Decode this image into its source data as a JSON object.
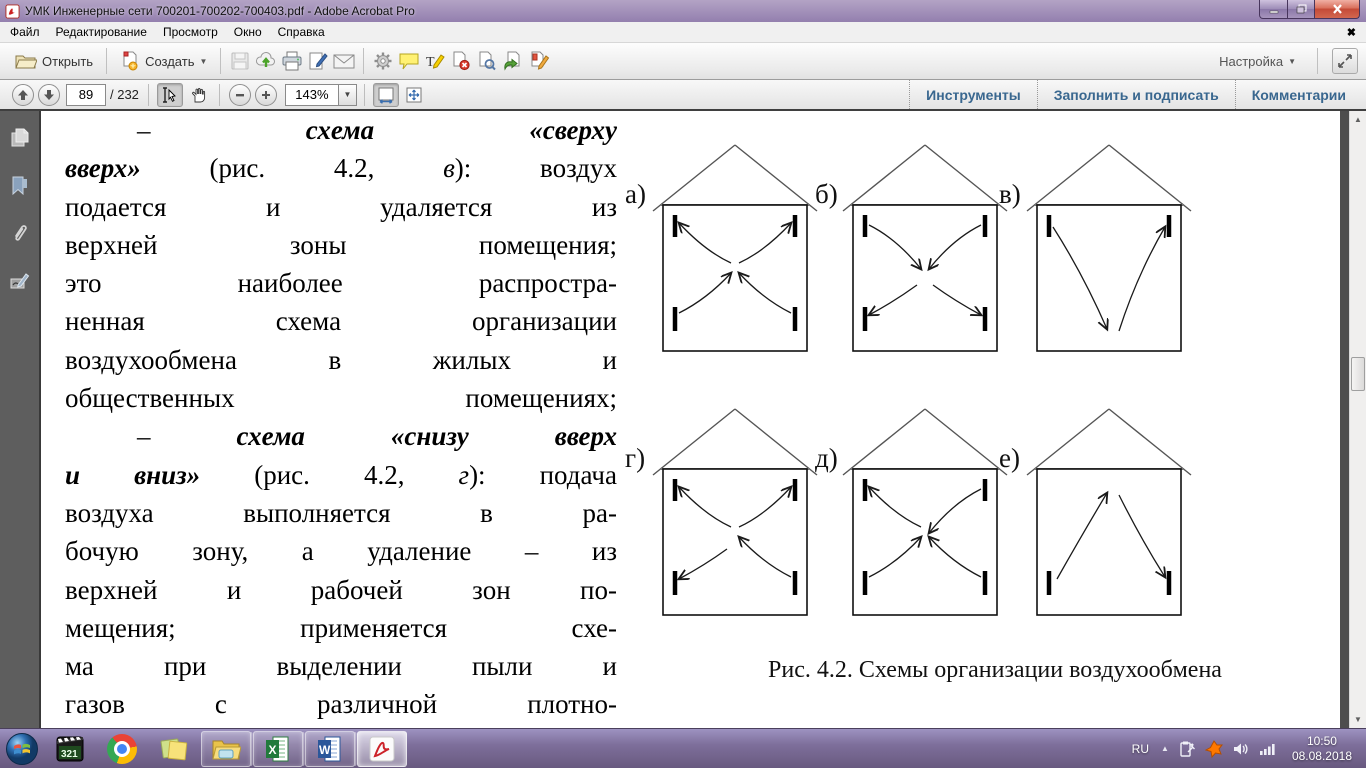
{
  "window": {
    "title": "УМК Инженерные сети 700201-700202-700403.pdf - Adobe Acrobat Pro",
    "controls": {
      "minimize": "minimize",
      "restore": "restore",
      "close": "close"
    }
  },
  "menubar": {
    "items": [
      "Файл",
      "Редактирование",
      "Просмотр",
      "Окно",
      "Справка"
    ],
    "doc_close_glyph": "✖"
  },
  "toolbar": {
    "open_label": "Открыть",
    "create_label": "Создать",
    "settings_label": "Настройка",
    "icons": [
      "open-folder-icon",
      "create-pdf-icon",
      "save-icon",
      "upload-cloud-icon",
      "print-icon",
      "sign-icon",
      "email-icon",
      "gear-icon",
      "comment-icon",
      "highlight-text-icon",
      "delete-pages-icon",
      "search-pages-icon",
      "send-pages-icon",
      "edit-document-icon",
      "reading-mode-icon"
    ]
  },
  "navbar": {
    "page_current": "89",
    "page_total": "/ 232",
    "zoom_level": "143%",
    "right_buttons": [
      "Инструменты",
      "Заполнить и подписать",
      "Комментарии"
    ]
  },
  "sidebar": {
    "icons": [
      "page-thumbnails-icon",
      "bookmarks-icon",
      "attachments-icon",
      "signatures-icon"
    ]
  },
  "document": {
    "text_lines": [
      {
        "indent": true,
        "segments": [
          {
            "t": "– ",
            "s": "n"
          },
          {
            "t": "схема «сверху",
            "s": "bi"
          }
        ]
      },
      {
        "indent": false,
        "segments": [
          {
            "t": "вверх»",
            "s": "bi"
          },
          {
            "t": " (рис. 4.2, ",
            "s": "n"
          },
          {
            "t": "в",
            "s": "i"
          },
          {
            "t": "): воздух",
            "s": "n"
          }
        ]
      },
      {
        "indent": false,
        "segments": [
          {
            "t": "подается и удаляется из",
            "s": "n"
          }
        ]
      },
      {
        "indent": false,
        "segments": [
          {
            "t": "верхней зоны помещения;",
            "s": "n"
          }
        ]
      },
      {
        "indent": false,
        "segments": [
          {
            "t": "это наиболее распростра-",
            "s": "n"
          }
        ]
      },
      {
        "indent": false,
        "segments": [
          {
            "t": "ненная схема организации",
            "s": "n"
          }
        ]
      },
      {
        "indent": false,
        "segments": [
          {
            "t": "воздухообмена в жилых и",
            "s": "n"
          }
        ]
      },
      {
        "indent": false,
        "segments": [
          {
            "t": "общественных помещениях;",
            "s": "n"
          }
        ]
      },
      {
        "indent": true,
        "segments": [
          {
            "t": "– ",
            "s": "n"
          },
          {
            "t": "схема «снизу вверх",
            "s": "bi"
          }
        ]
      },
      {
        "indent": false,
        "segments": [
          {
            "t": "и вниз»",
            "s": "bi"
          },
          {
            "t": " (рис. 4.2, ",
            "s": "n"
          },
          {
            "t": "г",
            "s": "i"
          },
          {
            "t": "): подача",
            "s": "n"
          }
        ]
      },
      {
        "indent": false,
        "segments": [
          {
            "t": "воздуха выполняется в ра-",
            "s": "n"
          }
        ]
      },
      {
        "indent": false,
        "segments": [
          {
            "t": "бочую зону, а удаление – из",
            "s": "n"
          }
        ]
      },
      {
        "indent": false,
        "segments": [
          {
            "t": "верхней и рабочей зон по-",
            "s": "n"
          }
        ]
      },
      {
        "indent": false,
        "segments": [
          {
            "t": "мещения; применяется схе-",
            "s": "n"
          }
        ]
      },
      {
        "indent": false,
        "segments": [
          {
            "t": "ма при выделении пыли и",
            "s": "n"
          }
        ]
      },
      {
        "indent": false,
        "segments": [
          {
            "t": "газов с различной плотно-",
            "s": "n"
          }
        ]
      }
    ],
    "figure": {
      "caption": "Рис. 4.2. Схемы организации воздухообмена",
      "diagrams": [
        {
          "label": "а)",
          "ticks": [
            "tl",
            "tr",
            "bl",
            "br"
          ],
          "arrows": [
            "bl-to-center",
            "br-to-center",
            "center-to-tl",
            "center-to-tr"
          ]
        },
        {
          "label": "б)",
          "ticks": [
            "tl",
            "tr",
            "bl",
            "br"
          ],
          "arrows": [
            "tl-to-center",
            "tr-to-center",
            "center-to-bl",
            "center-to-br"
          ]
        },
        {
          "label": "в)",
          "ticks": [
            "tl",
            "tr"
          ],
          "arrows": [
            "tl-to-bottom",
            "bottom-to-tr"
          ]
        },
        {
          "label": "г)",
          "ticks": [
            "tl",
            "tr",
            "bl",
            "br"
          ],
          "arrows": [
            "center-to-tl",
            "center-to-tr",
            "center-to-bl",
            "br-to-center"
          ]
        },
        {
          "label": "д)",
          "ticks": [
            "tl",
            "tr",
            "bl",
            "br"
          ],
          "arrows": [
            "center-to-tl",
            "tr-to-center",
            "bl-to-center",
            "br-to-center"
          ]
        },
        {
          "label": "е)",
          "ticks": [
            "bl",
            "br"
          ],
          "arrows": [
            "bl-to-top",
            "top-to-br"
          ]
        }
      ]
    }
  },
  "taskbar": {
    "apps": [
      "start",
      "media-player-321",
      "chrome",
      "sticky-notes",
      "explorer",
      "excel",
      "word",
      "acrobat"
    ],
    "media_player_label": "321",
    "tray": {
      "lang": "RU",
      "time": "10:50",
      "date": "08.08.2018"
    }
  },
  "colors": {
    "titlebar": "#a693bd",
    "taskbar": "#7e6f9b",
    "accent_blue_links": "#39678f",
    "sidebar_gray": "#5e5e5e",
    "close_button_red": "#c44a37"
  }
}
